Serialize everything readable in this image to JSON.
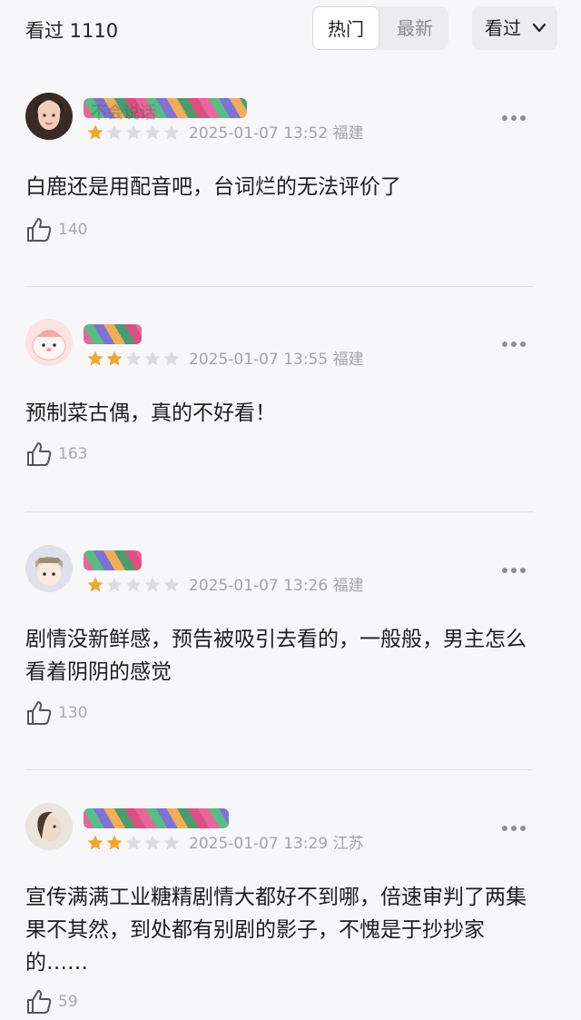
{
  "header": {
    "seen_label": "看过 1110",
    "tabs": [
      "热门",
      "最新"
    ],
    "active_tab": "热门",
    "filter_label": "看过"
  },
  "comments": [
    {
      "name": "不会说话",
      "stars": 1,
      "date": "2025-01-07 13:52",
      "location": "福建",
      "text": "白鹿还是用配音吧，台词烂的无法评价了",
      "likes": "140"
    },
    {
      "name": "",
      "stars": 2,
      "date": "2025-01-07 13:55",
      "location": "福建",
      "text": "预制菜古偶，真的不好看！",
      "likes": "163"
    },
    {
      "name": "",
      "stars": 1,
      "date": "2025-01-07 13:26",
      "location": "福建",
      "text": "剧情没新鲜感，预告被吸引去看的，一般般，男主怎么看着阴阴的感觉",
      "likes": "130"
    },
    {
      "name": "",
      "stars": 2,
      "date": "2025-01-07 13:29",
      "location": "江苏",
      "text": "宣传满满工业糖精剧情大都好不到哪，倍速审判了两集果不其然，到处都有别剧的影子，不愧是于抄抄家的……",
      "likes": "59"
    }
  ],
  "colors": {
    "star_filled": "#f2a531",
    "star_empty": "#dcdce0",
    "meta_text": "#a3a3a8"
  },
  "icons": [
    "chevron-down-icon",
    "star-icon",
    "more-icon",
    "thumbs-up-icon"
  ]
}
